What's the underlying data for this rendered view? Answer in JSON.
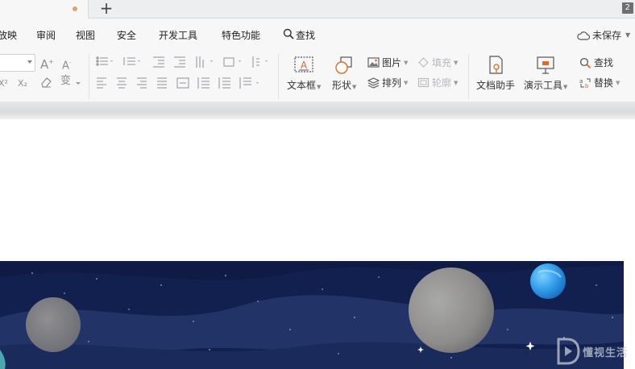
{
  "tabbar": {
    "new_tab_symbol": "+",
    "window_count": "2",
    "unsaved_dot_color": "#e3a46a"
  },
  "menu": {
    "items": [
      "放映",
      "审阅",
      "视图",
      "安全",
      "开发工具",
      "特色功能"
    ],
    "search_label": "查找",
    "save_status": "未保存"
  },
  "ribbon": {
    "text_box": "文本框",
    "shape": "形状",
    "picture": "图片",
    "fill": "填充",
    "arrange": "排列",
    "outline": "轮廓",
    "doc_assistant": "文档助手",
    "presentation_tools": "演示工具",
    "find": "查找",
    "replace": "替换"
  },
  "slide": {
    "background_color": "#12204f"
  },
  "watermark": {
    "text": "懂视生活"
  }
}
